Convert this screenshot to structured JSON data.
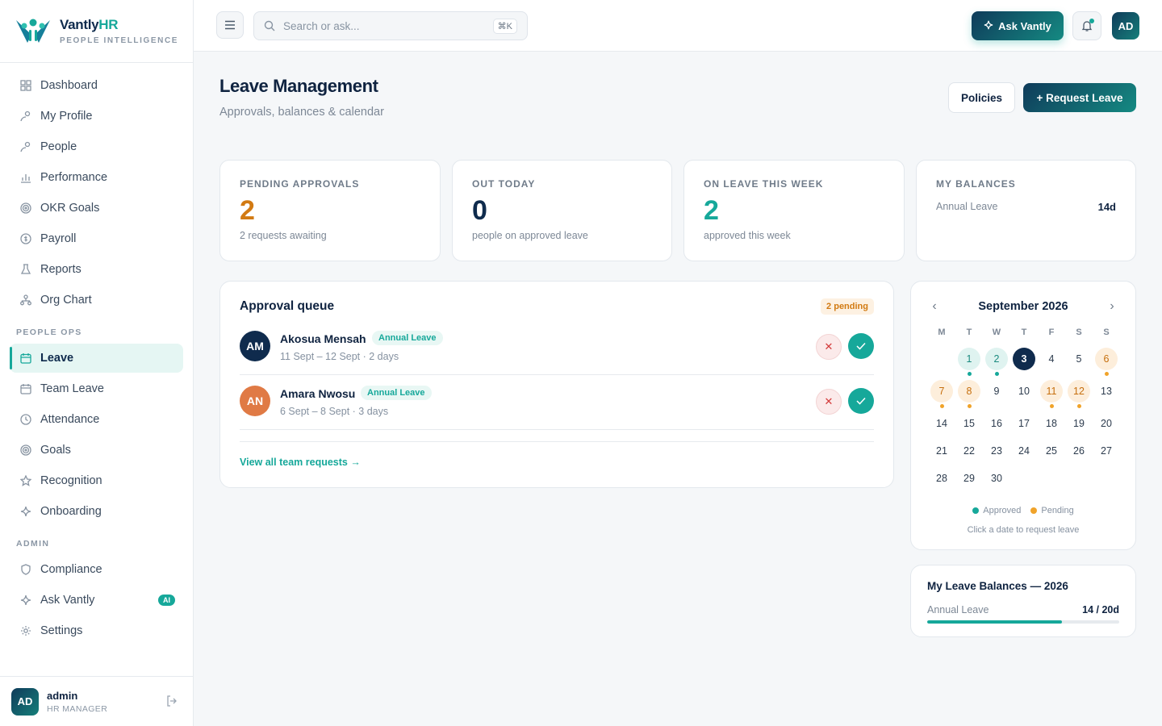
{
  "brand": {
    "name_main": "Vantly",
    "name_accent": "HR",
    "subtitle": "PEOPLE INTELLIGENCE"
  },
  "sidebar": {
    "items": [
      {
        "label": "Dashboard",
        "icon": "grid-icon"
      },
      {
        "label": "My Profile",
        "icon": "user-icon"
      },
      {
        "label": "People",
        "icon": "users-icon"
      },
      {
        "label": "Performance",
        "icon": "bar-chart-icon"
      },
      {
        "label": "OKR Goals",
        "icon": "target-icon"
      },
      {
        "label": "Payroll",
        "icon": "dollar-icon"
      },
      {
        "label": "Reports",
        "icon": "flask-icon"
      },
      {
        "label": "Org Chart",
        "icon": "org-chart-icon"
      }
    ],
    "section_people_ops": "PEOPLE OPS",
    "people_ops_items": [
      {
        "label": "Leave",
        "icon": "calendar-icon",
        "active": true
      },
      {
        "label": "Team Leave",
        "icon": "calendar-icon"
      },
      {
        "label": "Attendance",
        "icon": "clock-icon"
      },
      {
        "label": "Goals",
        "icon": "target-icon"
      },
      {
        "label": "Recognition",
        "icon": "star-icon"
      },
      {
        "label": "Onboarding",
        "icon": "sparkle-icon"
      }
    ],
    "section_admin": "ADMIN",
    "admin_items": [
      {
        "label": "Compliance",
        "icon": "shield-icon"
      },
      {
        "label": "Ask Vantly",
        "icon": "sparkle-icon",
        "badge": "AI"
      },
      {
        "label": "Settings",
        "icon": "gear-icon"
      }
    ],
    "user": {
      "initials": "AD",
      "name": "admin",
      "role": "HR MANAGER"
    }
  },
  "topbar": {
    "search_placeholder": "Search or ask...",
    "search_shortcut": "⌘K",
    "ask_label": "Ask Vantly",
    "avatar_initials": "AD"
  },
  "page": {
    "title": "Leave Management",
    "subtitle": "Approvals, balances & calendar",
    "policies_label": "Policies",
    "request_label": "+ Request Leave"
  },
  "stats": [
    {
      "label": "PENDING APPROVALS",
      "value": "2",
      "desc": "2 requests awaiting",
      "color": "#d27a12"
    },
    {
      "label": "OUT TODAY",
      "value": "0",
      "desc": "people on approved leave",
      "color": "#0f2b4d"
    },
    {
      "label": "ON LEAVE THIS WEEK",
      "value": "2",
      "desc": "approved this week",
      "color": "#16a89a"
    }
  ],
  "my_balances": {
    "label": "MY BALANCES",
    "row_label": "Annual Leave",
    "row_value": "14d"
  },
  "queue": {
    "title": "Approval queue",
    "badge": "2 pending",
    "requests": [
      {
        "initials": "AM",
        "name": "Akosua Mensah",
        "type": "Annual Leave",
        "dates": "11 Sept – 12 Sept · 2 days",
        "avatar_color": "#0f2b4d"
      },
      {
        "initials": "AN",
        "name": "Amara Nwosu",
        "type": "Annual Leave",
        "dates": "6 Sept – 8 Sept · 3 days",
        "avatar_color": "#e07a45"
      }
    ],
    "view_all": "View all team requests →"
  },
  "calendar": {
    "title": "September 2026",
    "dow": [
      "M",
      "T",
      "W",
      "T",
      "F",
      "S",
      "S"
    ],
    "first_weekday_index": 1,
    "days_in_month": 30,
    "today": 3,
    "approved_days": [
      1,
      2
    ],
    "pending_days": [
      6,
      7,
      8,
      11,
      12
    ],
    "dot_days_approved": [
      1,
      2
    ],
    "dot_days_pending": [
      6,
      7,
      8,
      11,
      12
    ],
    "legend_approved": "Approved",
    "legend_pending": "Pending",
    "hint": "Click a date to request leave"
  },
  "balances": {
    "title": "My Leave Balances — 2026",
    "label": "Annual Leave",
    "value": "14 / 20d",
    "used": 14,
    "total": 20
  }
}
